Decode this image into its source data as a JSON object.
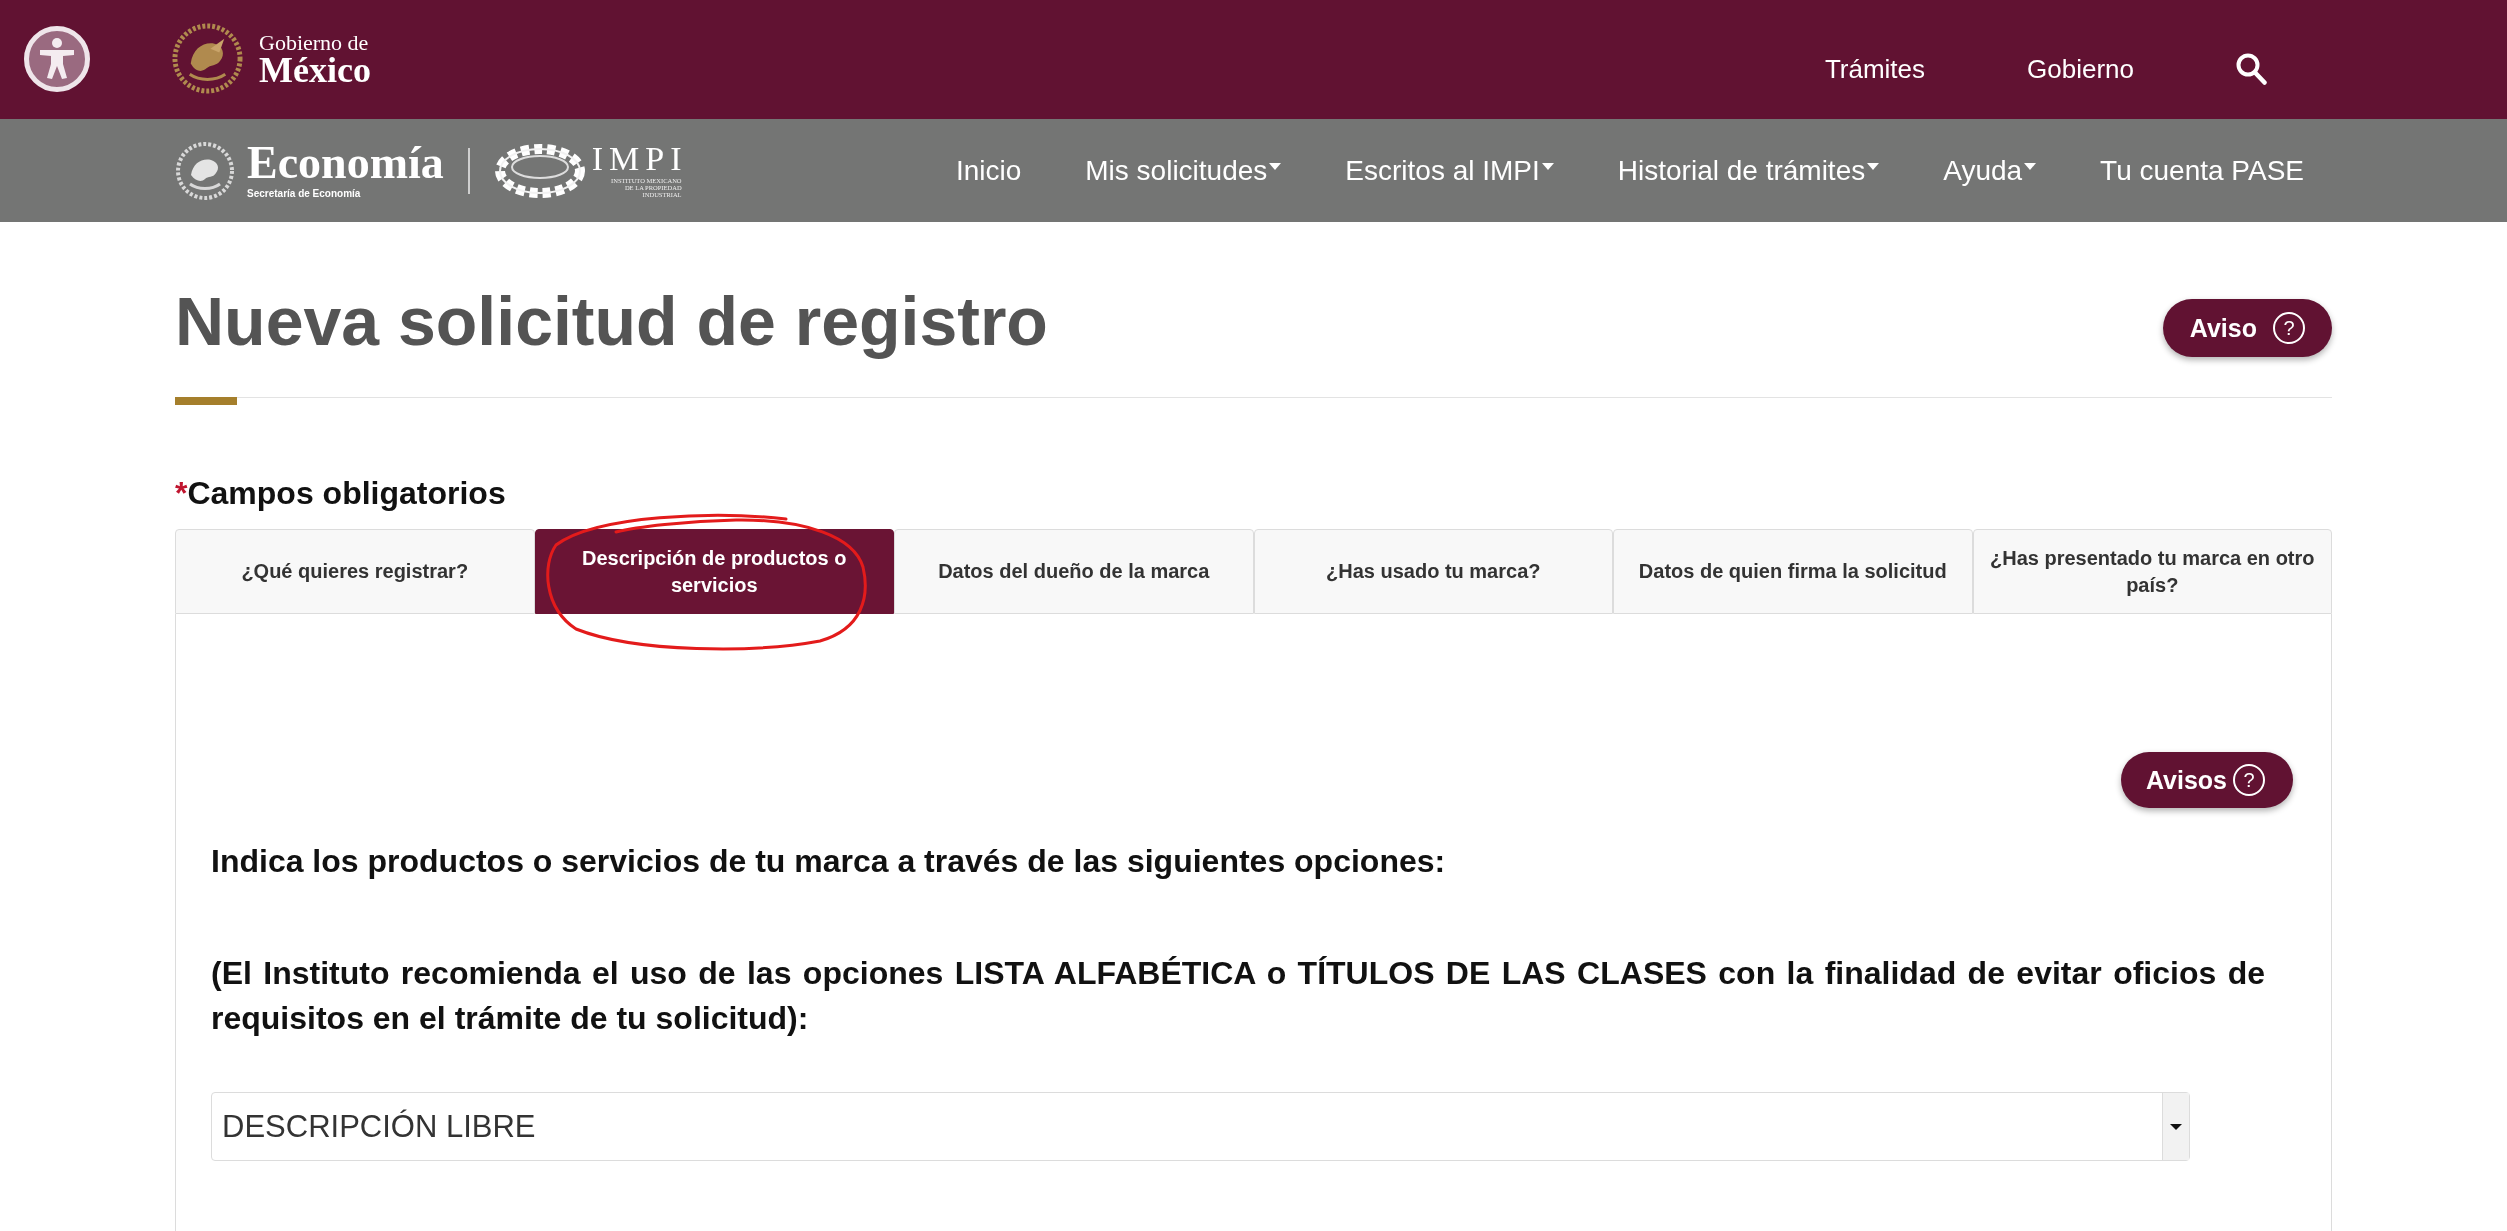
{
  "header": {
    "logo": {
      "line_1": "Gobierno de",
      "line_2": "México"
    },
    "links": [
      {
        "label": "Trámites"
      },
      {
        "label": "Gobierno"
      }
    ]
  },
  "navbar": {
    "logo": {
      "name": "Economía",
      "subtitle": "Secretaría de Economía",
      "partner_name": "IMPI",
      "partner_subtitle": [
        "INSTITUTO MEXICANO",
        "DE LA PROPIEDAD",
        "INDUSTRIAL"
      ]
    },
    "items": [
      {
        "label": "Inicio",
        "dropdown": false
      },
      {
        "label": "Mis solicitudes",
        "dropdown": true
      },
      {
        "label": "Escritos al IMPI",
        "dropdown": true
      },
      {
        "label": "Historial de trámites",
        "dropdown": true
      },
      {
        "label": "Ayuda",
        "dropdown": true
      },
      {
        "label": "Tu cuenta PASE",
        "dropdown": false
      }
    ]
  },
  "page": {
    "title": "Nueva solicitud de registro",
    "notice_button": {
      "label": "Aviso",
      "icon": "?"
    }
  },
  "required_note": {
    "mark": "*",
    "label": "Campos obligatorios"
  },
  "tabs": [
    {
      "label": "¿Qué quieres registrar?",
      "selected": false,
      "circled": false
    },
    {
      "label": "Descripción de productos o servicios",
      "selected": true,
      "circled": true
    },
    {
      "label": "Datos del dueño de la marca",
      "selected": false,
      "circled": false
    },
    {
      "label": "¿Has usado tu marca?",
      "selected": false,
      "circled": false
    },
    {
      "label": "Datos de quien firma la solicitud",
      "selected": false,
      "circled": false
    },
    {
      "label": "¿Has presentado tu marca en otro país?",
      "selected": false,
      "circled": false
    }
  ],
  "panel": {
    "notices_button": {
      "label": "Avisos",
      "icon": "?"
    },
    "instructions": "Indica los productos o servicios de tu marca a través de las siguientes opciones:",
    "recommendation": "(El Instituto recomienda el uso de las opciones LISTA ALFABÉTICA o TÍTULOS DE LAS CLASES con la finalidad de evitar oficios de requisitos en el trámite de tu solicitud):",
    "select": {
      "value": "DESCRIPCIÓN LIBRE"
    }
  }
}
